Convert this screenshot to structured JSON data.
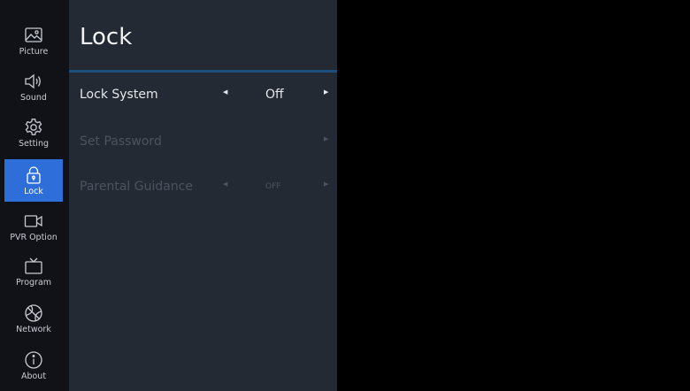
{
  "sidebar": {
    "items": [
      {
        "label": "Picture",
        "icon": "picture-icon"
      },
      {
        "label": "Sound",
        "icon": "speaker-icon"
      },
      {
        "label": "Setting",
        "icon": "gear-icon"
      },
      {
        "label": "Lock",
        "icon": "lock-icon",
        "active": true
      },
      {
        "label": "PVR Option",
        "icon": "video-camera-icon"
      },
      {
        "label": "Program",
        "icon": "tv-icon"
      },
      {
        "label": "Network",
        "icon": "globe-icon"
      },
      {
        "label": "About",
        "icon": "info-icon"
      }
    ]
  },
  "panel": {
    "title": "Lock",
    "rows": [
      {
        "label": "Lock System",
        "value": "Off",
        "enabled": true
      },
      {
        "label": "Set Password",
        "value": "",
        "enabled": false
      },
      {
        "label": "Parental Guidance",
        "value": "OFF",
        "enabled": false
      }
    ]
  },
  "colors": {
    "sidebar_bg": "#101218",
    "panel_bg": "#232a33",
    "active": "#2d6ed8",
    "divider": "#1d4f7d",
    "background": "#000000"
  }
}
